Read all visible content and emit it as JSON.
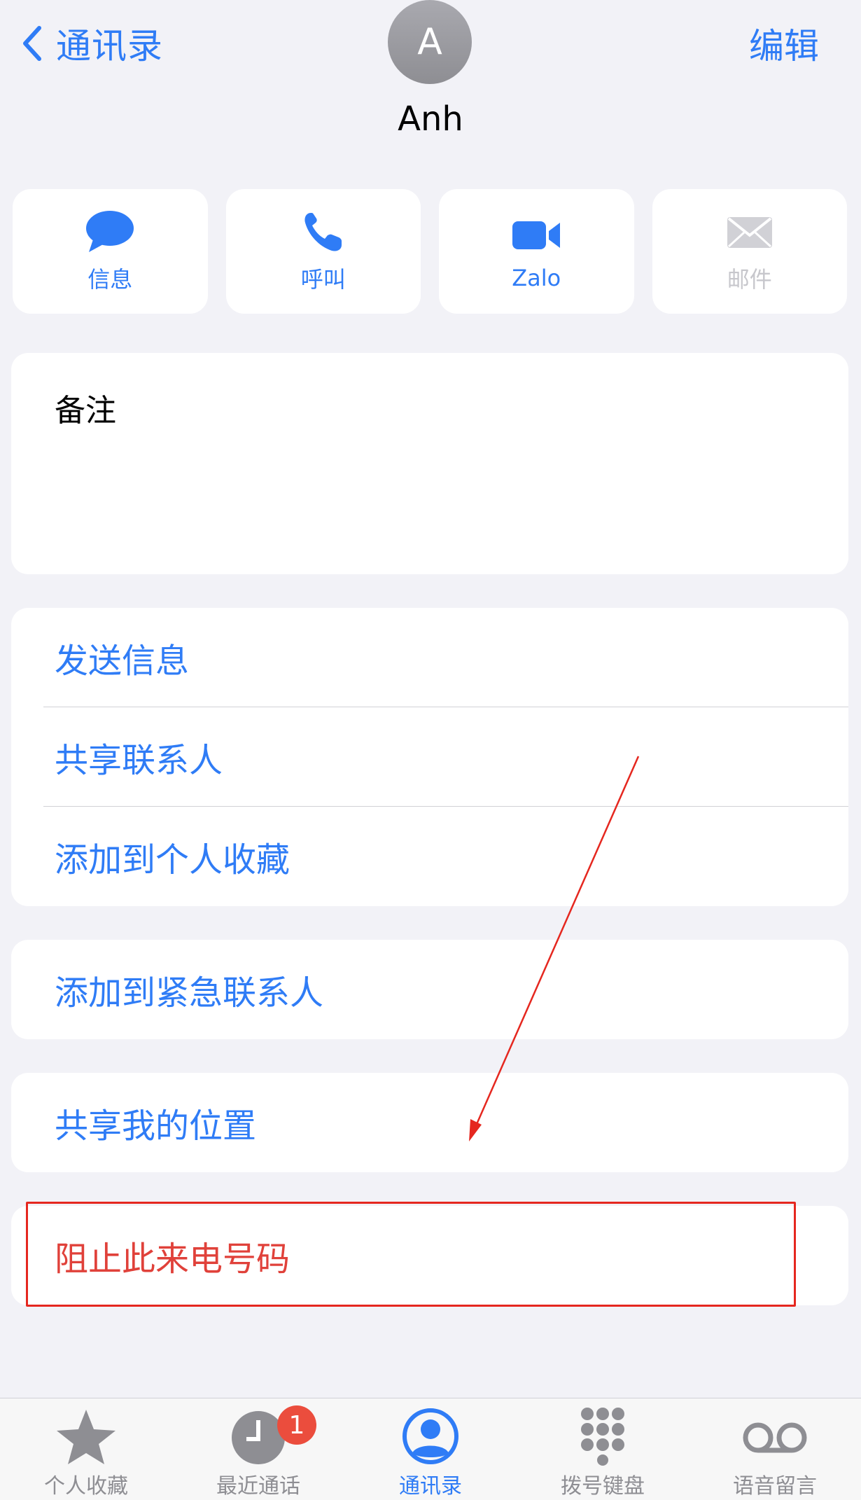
{
  "header": {
    "back_label": "通讯录",
    "edit_label": "编辑",
    "avatar_initial": "A",
    "contact_name": "Anh"
  },
  "actions": [
    {
      "label": "信息",
      "icon": "message-bubble-icon",
      "enabled": true
    },
    {
      "label": "呼叫",
      "icon": "phone-icon",
      "enabled": true
    },
    {
      "label": "Zalo",
      "icon": "video-camera-icon",
      "enabled": true
    },
    {
      "label": "邮件",
      "icon": "envelope-icon",
      "enabled": false
    }
  ],
  "notes": {
    "label": "备注"
  },
  "list": {
    "send_message": "发送信息",
    "share_contact": "共享联系人",
    "add_favorites": "添加到个人收藏",
    "add_emergency": "添加到紧急联系人",
    "share_location": "共享我的位置",
    "block_caller": "阻止此来电号码"
  },
  "tabs": [
    {
      "label": "个人收藏",
      "icon": "star-icon"
    },
    {
      "label": "最近通话",
      "icon": "clock-icon",
      "badge": "1"
    },
    {
      "label": "通讯录",
      "icon": "person-circle-icon",
      "active": true
    },
    {
      "label": "拨号键盘",
      "icon": "keypad-icon"
    },
    {
      "label": "语音留言",
      "icon": "voicemail-icon"
    }
  ],
  "colors": {
    "accent": "#2F7CF6",
    "danger": "#E0413A",
    "annotation": "#E5271F",
    "background": "#F2F2F7",
    "badge": "#EB4D3D"
  }
}
